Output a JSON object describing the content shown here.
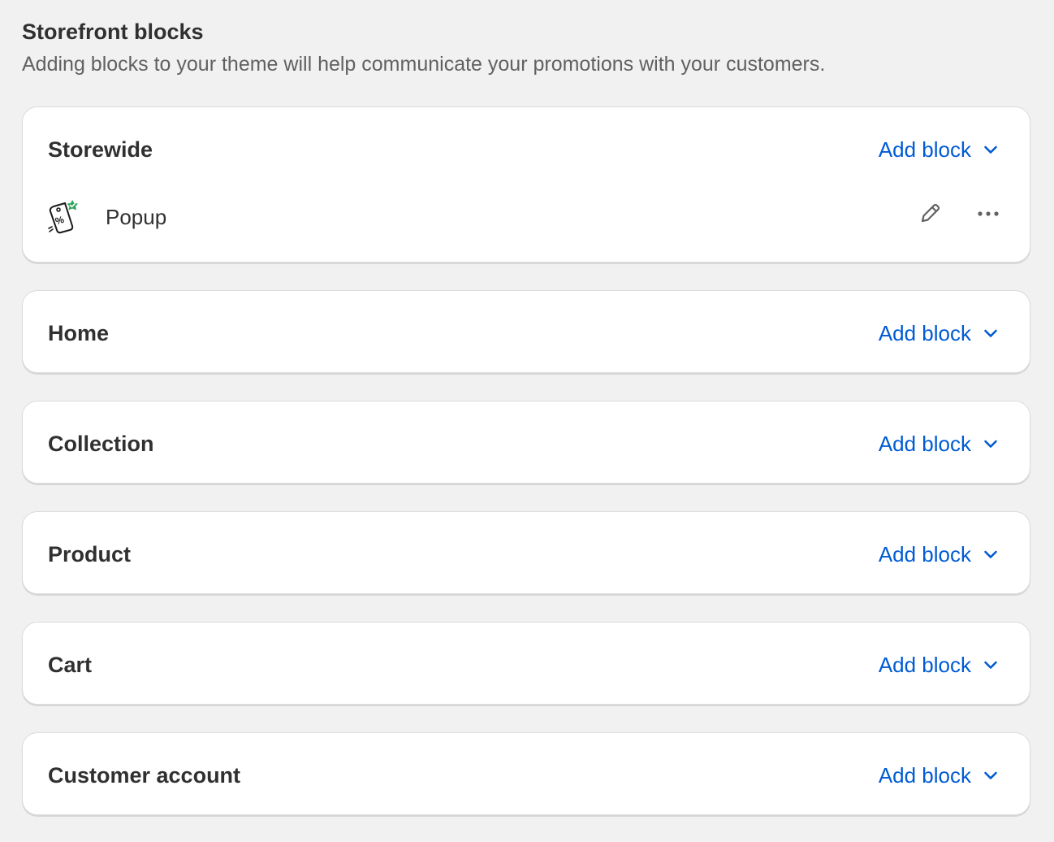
{
  "header": {
    "title": "Storefront blocks",
    "subtitle": "Adding blocks to your theme will help communicate your promotions with your customers."
  },
  "colors": {
    "background": "#f1f1f1",
    "card": "#ffffff",
    "link": "#005bd3",
    "text": "#303030",
    "subdued": "#616161",
    "icon_badge": "#29a55b"
  },
  "sections": [
    {
      "title": "Storewide",
      "action_label": "Add block",
      "blocks": [
        {
          "label": "Popup",
          "icon": "discount-tag-icon"
        }
      ]
    },
    {
      "title": "Home",
      "action_label": "Add block",
      "blocks": []
    },
    {
      "title": "Collection",
      "action_label": "Add block",
      "blocks": []
    },
    {
      "title": "Product",
      "action_label": "Add block",
      "blocks": []
    },
    {
      "title": "Cart",
      "action_label": "Add block",
      "blocks": []
    },
    {
      "title": "Customer account",
      "action_label": "Add block",
      "blocks": []
    }
  ]
}
